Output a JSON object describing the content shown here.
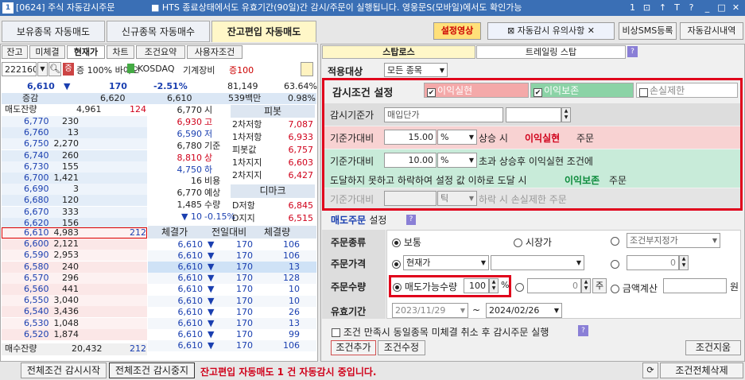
{
  "window": {
    "title": "[0624] 주식 자동감시주문",
    "notice": "HTS 종료상태에서도 유효기간(90일)간 감시/주문이 실행됩니다. 영웅문S(모바일)에서도 확인가능"
  },
  "top_tabs": [
    "보유종목 자동매도",
    "신규종목 자동매수",
    "잔고편입 자동매도"
  ],
  "top_buttons": {
    "setup_video": "설정영상",
    "caution": "자동감시 유의사항",
    "sms": "비상SMS등록",
    "history": "자동감시내역"
  },
  "left_tabs": [
    "잔고",
    "미체결",
    "현재가",
    "차트",
    "조건요약",
    "사용자조건"
  ],
  "stock": {
    "code": "222160",
    "percent_label": "증 100%",
    "name": "바이오",
    "market": "KOSDAQ",
    "sector": "기계장비",
    "margin": "증100"
  },
  "quote": {
    "price": "6,610",
    "arrow": "▼",
    "change": "170",
    "rate": "-2.51%",
    "volume": "81,149",
    "vol_rate": "63.64%",
    "label_up": "증감",
    "bid_amt": "6,620",
    "ask_amt": "6,610",
    "amount": "539백만",
    "ratio": "0.98%"
  },
  "orderbook": {
    "ask_header": "매도잔량",
    "ask_header_val1": "4,961",
    "ask_header_val2": "124",
    "asks": [
      [
        "6,770",
        "230"
      ],
      [
        "6,760",
        "13"
      ],
      [
        "6,750",
        "2,270"
      ],
      [
        "6,740",
        "260"
      ],
      [
        "6,730",
        "155"
      ],
      [
        "6,700",
        "1,421"
      ],
      [
        "6,690",
        "3"
      ],
      [
        "6,680",
        "120"
      ],
      [
        "6,670",
        "333"
      ],
      [
        "6,620",
        "156"
      ]
    ],
    "bids": [
      [
        "6,610",
        "4,983",
        "212"
      ],
      [
        "6,600",
        "2,121",
        ""
      ],
      [
        "6,590",
        "2,953",
        ""
      ],
      [
        "6,580",
        "240",
        ""
      ],
      [
        "6,570",
        "296",
        ""
      ],
      [
        "6,560",
        "441",
        ""
      ],
      [
        "6,550",
        "3,040",
        ""
      ],
      [
        "6,540",
        "3,436",
        ""
      ],
      [
        "6,530",
        "1,048",
        ""
      ],
      [
        "6,520",
        "1,874",
        ""
      ]
    ],
    "bid_footer": "매수잔량",
    "bid_footer_val1": "20,432",
    "bid_footer_val2": "212"
  },
  "price_info": [
    [
      "6,770",
      "시"
    ],
    [
      "6,930",
      "고"
    ],
    [
      "6,590",
      "저"
    ],
    [
      "6,780",
      "기준"
    ],
    [
      "8,810",
      "상"
    ],
    [
      "4,750",
      "하"
    ],
    [
      "16",
      "비용"
    ],
    [
      "6,770",
      "예상"
    ],
    [
      "1,485",
      "수량"
    ],
    [
      "▼ 10",
      "-0.15%"
    ]
  ],
  "pivot": {
    "title": "피봇",
    "rows": [
      [
        "2차저항",
        "7,087"
      ],
      [
        "1차저항",
        "6,933"
      ],
      [
        "피봇값",
        "6,757"
      ],
      [
        "1차지지",
        "6,603"
      ],
      [
        "2차지지",
        "6,427"
      ]
    ],
    "dmark_title": "디마크",
    "dmark": [
      [
        "D저항",
        "6,845"
      ],
      [
        "D지지",
        "6,515"
      ]
    ]
  },
  "trades": {
    "headers": [
      "체결가",
      "전일대비",
      "체결량"
    ],
    "rows": [
      [
        "6,610",
        "170",
        "106"
      ],
      [
        "6,610",
        "170",
        "106"
      ],
      [
        "6,610",
        "170",
        "13"
      ],
      [
        "6,610",
        "170",
        "128"
      ],
      [
        "6,610",
        "170",
        "10"
      ],
      [
        "6,610",
        "170",
        "10"
      ],
      [
        "6,610",
        "170",
        "26"
      ],
      [
        "6,610",
        "170",
        "13"
      ],
      [
        "6,610",
        "170",
        "99"
      ],
      [
        "6,610",
        "170",
        "106"
      ]
    ]
  },
  "strategy_tabs": [
    "스탑로스",
    "트레일링 스탑"
  ],
  "target": {
    "label": "적용대상",
    "value": "모든 종목"
  },
  "condition": {
    "title": "감시조건 설정",
    "opt_profit": "이익실현",
    "opt_preserve": "이익보존",
    "opt_loss": "손실제한",
    "base_label": "감시기준가",
    "base_value": "매입단가",
    "row1_label": "기준가대비",
    "row1_value": "15.00",
    "row1_unit": "%",
    "row1_tail": "상승 시",
    "row1_hl": "이익실현",
    "row1_end": "주문",
    "row2_label": "기준가대비",
    "row2_value": "10.00",
    "row2_unit": "%",
    "row2_tail": "초과 상승후 이익실현 조건에",
    "row2b_text": "도달하지 못하고 하락하여 설정 값 이하로 도달 시",
    "row2b_hl": "이익보존",
    "row2b_end": "주문",
    "row3_label": "기준가대비",
    "row3_value": "",
    "row3_unit": "틱",
    "row3_tail": "하락 시 손실제한 주문"
  },
  "sell_order": {
    "title": "매도주문",
    "title2": "설정",
    "type_label": "주문종류",
    "type_opts": [
      "보통",
      "시장가",
      "조건부지정가"
    ],
    "price_label": "주문가격",
    "price_value": "현재가",
    "price_num": "0",
    "qty_label": "주문수량",
    "qty_opt": "매도가능수량",
    "qty_value": "100",
    "qty_unit": "%",
    "qty_num": "0",
    "qty_unit2": "주",
    "qty_calc": "금액계산",
    "qty_won": "원",
    "valid_label": "유효기간",
    "date_from": "2023/11/29",
    "date_to": "2024/02/26"
  },
  "footer_opts": {
    "cancel_text": "조건 만족시 동일종목 미체결 취소 후 감시주문 실행",
    "add": "조건추가",
    "modify": "조건수정",
    "delete": "조건지움"
  },
  "bottom": {
    "start_all": "전체조건 감시시작",
    "stop_all": "전체조건 감시중지",
    "status": "잔고편입 자동매도 1 건 자동감시 중입니다.",
    "delete_all": "조건전체삭제"
  }
}
